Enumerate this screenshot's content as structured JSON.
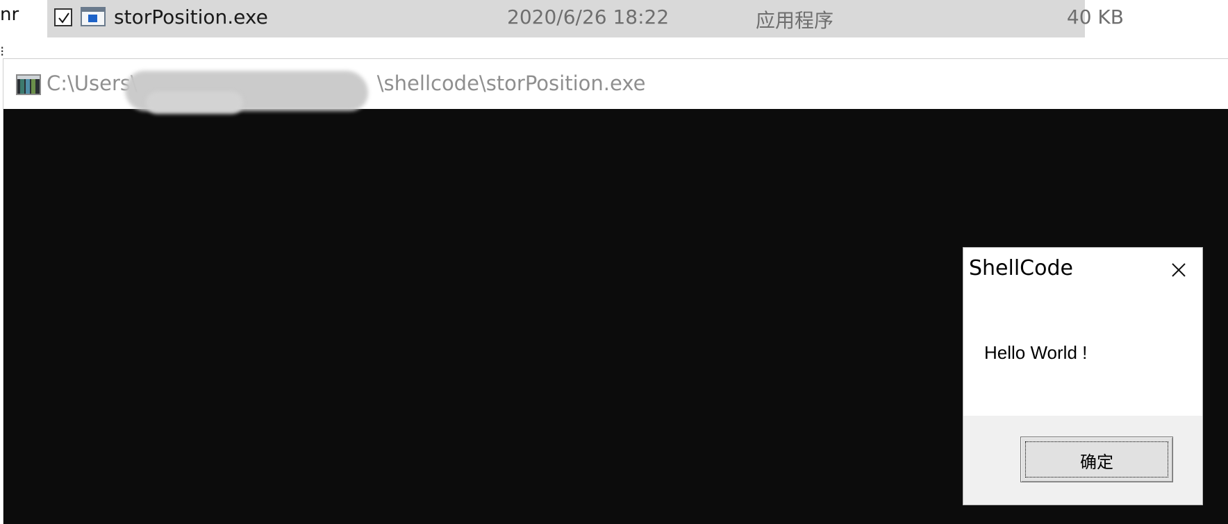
{
  "explorer": {
    "edge_text": "nr",
    "edge_mark": "⁝",
    "selected_file": {
      "checked": true,
      "icon": "exe-file-icon",
      "name": "storPosition.exe",
      "modified": "2020/6/26 18:22",
      "type": "应用程序",
      "size": "40 KB"
    }
  },
  "console": {
    "icon": "console-app-icon",
    "title_prefix": "C:\\Users\\",
    "title_suffix": "\\shellcode\\storPosition.exe",
    "background": "#0c0c0c"
  },
  "message_box": {
    "title": "ShellCode",
    "close_icon": "close-icon",
    "message": "Hello World !",
    "ok_label": "确定"
  },
  "colors": {
    "row_highlight": "#d9d9d9",
    "file_icon_blue": "#1e63c8",
    "title_gray": "#8f8f8f"
  }
}
